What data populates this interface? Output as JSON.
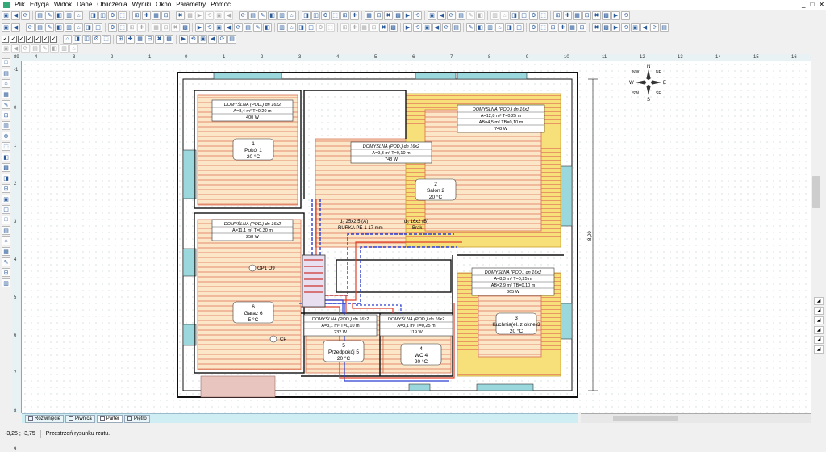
{
  "menu": [
    "Plik",
    "Edycja",
    "Widok",
    "Dane",
    "Obliczenia",
    "Wyniki",
    "Okno",
    "Parametry",
    "Pomoc"
  ],
  "window_controls": {
    "minimize": "_",
    "restore": "□",
    "close": "✕"
  },
  "tabs": [
    {
      "label": "Rozwinięcie",
      "active": false
    },
    {
      "label": "Piwnica",
      "active": false
    },
    {
      "label": "Parter",
      "active": true
    },
    {
      "label": "Piętro",
      "active": false
    }
  ],
  "status": {
    "coords": "-3,25 ; -3,75",
    "message": "Przestrzeń rysunku rzutu."
  },
  "ruler_top": [
    "-4",
    "-3",
    "-2",
    "-1",
    "0",
    "1",
    "2",
    "3",
    "4",
    "5",
    "6",
    "7",
    "8",
    "9",
    "10",
    "11",
    "12",
    "13",
    "14",
    "15",
    "16"
  ],
  "ruler_top_corner": "89",
  "ruler_left": [
    "-1",
    "0",
    "1",
    "2",
    "3",
    "4",
    "5",
    "6",
    "7",
    "8",
    "9"
  ],
  "compass": {
    "n": "N",
    "ne": "NE",
    "e": "E",
    "se": "SE",
    "s": "S",
    "sw": "SW",
    "w": "W",
    "nw": "NW"
  },
  "dimension_label": "8,00",
  "rooms": [
    {
      "info": [
        "DOMYŚLNA (POD.) dn 16x2",
        "A=8,4 m² T=0,20 m",
        "400 W"
      ],
      "num": "1",
      "name": "Pokój 1",
      "temp": "20 °C"
    },
    {
      "info": [
        "DOMYŚLNA (POD.) dn 16x2",
        "A=9,3 m² T=0,10 m",
        "748 W"
      ],
      "num": "2",
      "name": "Salon 2",
      "temp": "20 °C"
    },
    {
      "info": [
        "DOMYŚLNA (POD.) dn 16x2",
        "A=12,8 m² T=0,25 m",
        "AB=4,5 m² TB=0,10 m",
        "748 W"
      ],
      "num": "",
      "name": "",
      "temp": ""
    },
    {
      "info": [
        "DOMYŚLNA (POD.) dn 16x2",
        "A=11,1 m² T=0,30 m",
        "258 W"
      ],
      "num": "6",
      "name": "Garaż 6",
      "temp": "5 °C"
    },
    {
      "info": [
        "DOMYŚLNA (POD.) dn 16x2",
        "A=8,3 m² T=0,25 m",
        "AB=2,9 m² TB=0,10 m",
        "365 W"
      ],
      "num": "3",
      "name": "Kuchnia(el. z okne)3",
      "temp": "20 °C"
    },
    {
      "info": [
        "DOMYŚLNA (POD.) dn 16x2",
        "A=3,1 m² T=0,10 m",
        "232 W"
      ],
      "num": "5",
      "name": "Przedpokój 5",
      "temp": "20 °C"
    },
    {
      "info": [
        "DOMYŚLNA (POD.) dn 16x2",
        "A=3,1 m² T=0,25 m",
        "119 W"
      ],
      "num": "4",
      "name": "WC 4",
      "temp": "20 °C"
    }
  ],
  "pipe_labels": {
    "left_line1": "d₀ 25x2,5 (A)",
    "left_line2": "RURKA PE-1 17 mm",
    "right_line1": "d₀ 16x2 (B)",
    "right_line2": "Brak"
  },
  "manifold_labels": {
    "op": "OP1 O9",
    "cp": "CP"
  },
  "colors": {
    "pipe_red": "#e0402a",
    "pipe_blue": "#2a3fd0",
    "floor_fill": "#fbe6c8",
    "edge_fill": "#f7e07a",
    "window": "#9ad8dd",
    "tab_bg": "#cfeef4"
  }
}
